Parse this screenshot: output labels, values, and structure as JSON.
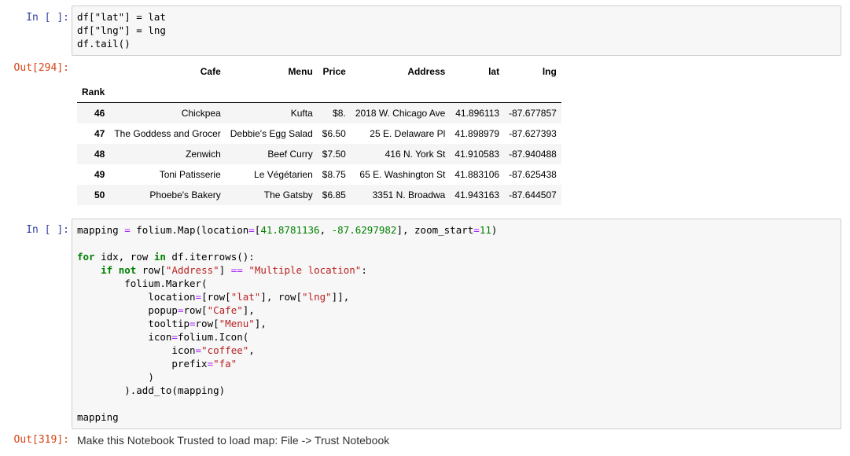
{
  "cell1": {
    "in_prompt": "In [ ]:",
    "code_lines": [
      "df[\"lat\"] = lat",
      "df[\"lng\"] = lng",
      "df.tail()"
    ],
    "out_prompt": "Out[294]:"
  },
  "table": {
    "columns": [
      "Cafe",
      "Menu",
      "Price",
      "Address",
      "lat",
      "lng"
    ],
    "index_name": "Rank",
    "rows": [
      {
        "rank": "46",
        "cafe": "Chickpea",
        "menu": "Kufta",
        "price": "$8.",
        "address": "2018 W. Chicago Ave",
        "lat": "41.896113",
        "lng": "-87.677857"
      },
      {
        "rank": "47",
        "cafe": "The Goddess and Grocer",
        "menu": "Debbie's Egg Salad",
        "price": "$6.50",
        "address": "25 E. Delaware Pl",
        "lat": "41.898979",
        "lng": "-87.627393"
      },
      {
        "rank": "48",
        "cafe": "Zenwich",
        "menu": "Beef Curry",
        "price": "$7.50",
        "address": "416 N. York St",
        "lat": "41.910583",
        "lng": "-87.940488"
      },
      {
        "rank": "49",
        "cafe": "Toni Patisserie",
        "menu": "Le Végétarien",
        "price": "$8.75",
        "address": "65 E. Washington St",
        "lat": "41.883106",
        "lng": "-87.625438"
      },
      {
        "rank": "50",
        "cafe": "Phoebe's Bakery",
        "menu": "The Gatsby",
        "price": "$6.85",
        "address": "3351 N. Broadwa",
        "lat": "41.943163",
        "lng": "-87.644507"
      }
    ]
  },
  "cell2": {
    "in_prompt": "In [ ]:",
    "out_prompt": "Out[319]:",
    "output_text": "Make this Notebook Trusted to load map: File -> Trust Notebook",
    "code": {
      "l1_a": "mapping ",
      "l1_b": "=",
      "l1_c": " folium.Map(location",
      "l1_d": "=",
      "l1_e": "[",
      "l1_f": "41.8781136",
      "l1_g": ", ",
      "l1_h": "-87.6297982",
      "l1_i": "], zoom_start",
      "l1_j": "=",
      "l1_k": "11",
      "l1_l": ")",
      "l2_kw1": "for",
      "l2_a": " idx, row ",
      "l2_kw2": "in",
      "l2_b": " df.iterrows():",
      "l3_kw1": "if",
      "l3_kw2": "not",
      "l3_a": " row[",
      "l3_s": "\"Address\"",
      "l3_b": "] ",
      "l3_op": "==",
      "l3_c": " ",
      "l3_s2": "\"Multiple location\"",
      "l3_d": ":",
      "l4": "folium.Marker(",
      "l5_a": "location",
      "l5_op": "=",
      "l5_b": "[row[",
      "l5_s1": "\"lat\"",
      "l5_c": "], row[",
      "l5_s2": "\"lng\"",
      "l5_d": "]],",
      "l6_a": "popup",
      "l6_op": "=",
      "l6_b": "row[",
      "l6_s": "\"Cafe\"",
      "l6_c": "],",
      "l7_a": "tooltip",
      "l7_op": "=",
      "l7_b": "row[",
      "l7_s": "\"Menu\"",
      "l7_c": "],",
      "l8_a": "icon",
      "l8_op": "=",
      "l8_b": "folium.Icon(",
      "l9_a": "icon",
      "l9_op": "=",
      "l9_s": "\"coffee\"",
      "l9_b": ",",
      "l10_a": "prefix",
      "l10_op": "=",
      "l10_s": "\"fa\"",
      "l11": ")",
      "l12": ").add_to(mapping)",
      "l13": "mapping"
    }
  }
}
